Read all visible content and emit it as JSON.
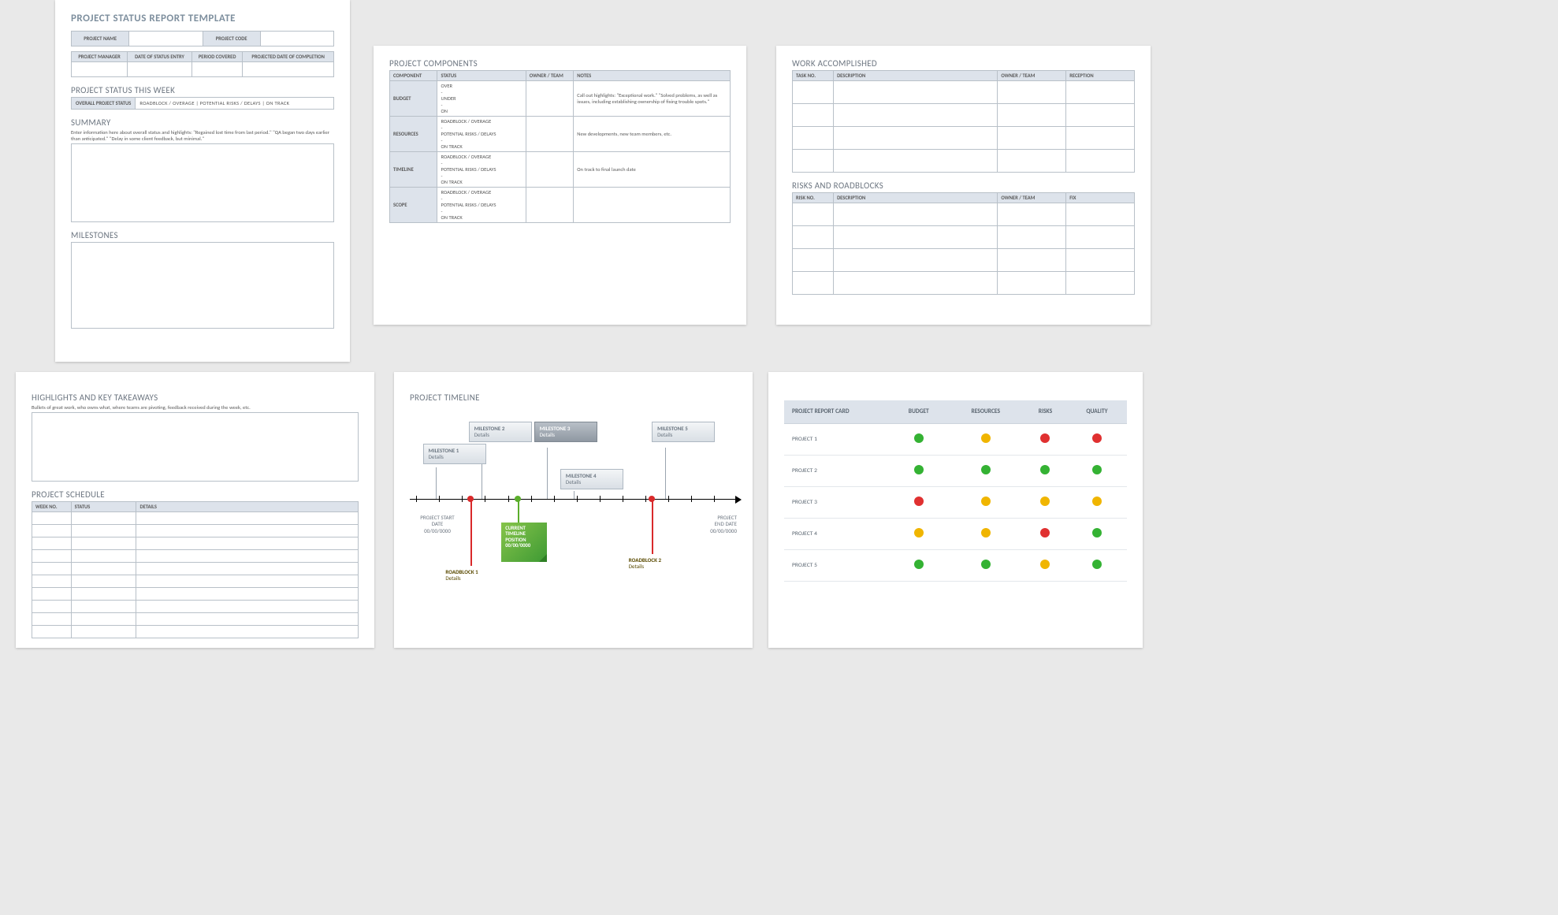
{
  "sheet1": {
    "title": "PROJECT STATUS REPORT TEMPLATE",
    "row1": {
      "name_label": "PROJECT NAME",
      "code_label": "PROJECT CODE"
    },
    "row2": [
      "PROJECT MANAGER",
      "DATE OF STATUS ENTRY",
      "PERIOD COVERED",
      "PROJECTED DATE OF COMPLETION"
    ],
    "status_week_title": "PROJECT STATUS THIS WEEK",
    "status_label": "OVERALL PROJECT STATUS",
    "status_opts": "ROADBLOCK / OVERAGE   |   POTENTIAL RISKS / DELAYS   |   ON TRACK",
    "summary_title": "SUMMARY",
    "summary_hint": "Enter information here about overall status and highlights: \"Regained lost time from last period.\" \"QA began two days earlier than anticipated.\" \"Delay in some client feedback, but minimal.\"",
    "milestones_title": "MILESTONES"
  },
  "sheet2": {
    "title": "PROJECT COMPONENTS",
    "headers": [
      "COMPONENT",
      "STATUS",
      "OWNER / TEAM",
      "NOTES"
    ],
    "rows": [
      {
        "comp": "BUDGET",
        "status": "OVER\n -\nUNDER\n -\nON",
        "note": "Call out highlights: \"Exceptional work.\" \"Solved problems, as well as issues, including establishing ownership of fixing trouble spots.\""
      },
      {
        "comp": "RESOURCES",
        "status": "ROADBLOCK / OVERAGE\n -\nPOTENTIAL RISKS / DELAYS\n -\nON TRACK",
        "note": "New developments, new team members, etc."
      },
      {
        "comp": "TIMELINE",
        "status": "ROADBLOCK / OVERAGE\n -\nPOTENTIAL RISKS / DELAYS\n -\nON TRACK",
        "note": "On track to final launch date"
      },
      {
        "comp": "SCOPE",
        "status": "ROADBLOCK / OVERAGE\n -\nPOTENTIAL RISKS / DELAYS\n -\nON TRACK",
        "note": ""
      }
    ]
  },
  "sheet3": {
    "work_title": "WORK ACCOMPLISHED",
    "work_headers": [
      "TASK NO.",
      "DESCRIPTION",
      "OWNER / TEAM",
      "RECEPTION"
    ],
    "risks_title": "RISKS AND ROADBLOCKS",
    "risks_headers": [
      "RISK NO.",
      "DESCRIPTION",
      "OWNER / TEAM",
      "FIX"
    ]
  },
  "sheet4": {
    "hi_title": "HIGHLIGHTS AND KEY TAKEAWAYS",
    "hi_hint": "Bullets of great work, who owns what, where teams are pivoting, feedback received during the week, etc.",
    "sched_title": "PROJECT SCHEDULE",
    "sched_headers": [
      "WEEK NO.",
      "STATUS",
      "DETAILS"
    ]
  },
  "sheet5": {
    "title": "PROJECT TIMELINE",
    "start": {
      "l1": "PROJECT START",
      "l2": "DATE",
      "l3": "00/00/0000"
    },
    "end": {
      "l1": "PROJECT",
      "l2": "END DATE",
      "l3": "00/00/0000"
    },
    "m": [
      "MILESTONE 1",
      "MILESTONE 2",
      "MILESTONE 3",
      "MILESTONE 4",
      "MILESTONE 5"
    ],
    "details": "Details",
    "rb": [
      "ROADBLOCK 1",
      "ROADBLOCK 2"
    ],
    "cur": {
      "l1": "CURRENT",
      "l2": "TIMELINE",
      "l3": "POSITION",
      "l4": "00/00/0000"
    }
  },
  "sheet6": {
    "headers": [
      "PROJECT REPORT CARD",
      "BUDGET",
      "RESOURCES",
      "RISKS",
      "QUALITY"
    ],
    "rows": [
      {
        "name": "PROJECT 1",
        "c": [
          "G",
          "Y",
          "R",
          "R"
        ]
      },
      {
        "name": "PROJECT 2",
        "c": [
          "G",
          "G",
          "G",
          "G"
        ]
      },
      {
        "name": "PROJECT 3",
        "c": [
          "R",
          "Y",
          "Y",
          "Y"
        ]
      },
      {
        "name": "PROJECT 4",
        "c": [
          "Y",
          "Y",
          "R",
          "G"
        ]
      },
      {
        "name": "PROJECT 5",
        "c": [
          "G",
          "G",
          "Y",
          "G"
        ]
      }
    ]
  }
}
